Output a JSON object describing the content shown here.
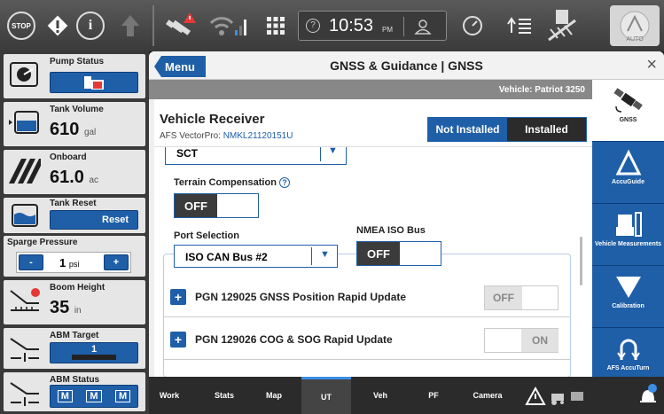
{
  "topbar": {
    "stop_label": "STOP",
    "info_label": "i",
    "clock_time": "10:53",
    "clock_ampm": "PM",
    "auto_label": "AUTO"
  },
  "left_panel": {
    "pump_status": {
      "title": "Pump Status"
    },
    "tank_volume": {
      "title": "Tank Volume",
      "value": "610",
      "unit": "gal"
    },
    "onboard": {
      "title": "Onboard",
      "value": "61.0",
      "unit": "ac"
    },
    "tank_reset": {
      "title": "Tank Reset",
      "button": "Reset"
    },
    "sparge": {
      "title": "Sparge Pressure",
      "value": "1",
      "unit": "psi",
      "minus": "-",
      "plus": "+"
    },
    "boom_height": {
      "title": "Boom Height",
      "value": "35",
      "unit": "in"
    },
    "abm_target": {
      "title": "ABM Target",
      "value": "1"
    },
    "abm_status": {
      "title": "ABM Status",
      "badges": [
        "M",
        "M",
        "M"
      ]
    }
  },
  "header": {
    "menu": "Menu",
    "title": "GNSS & Guidance | GNSS",
    "close": "×"
  },
  "vehicle_bar": "Vehicle: Patriot 3250",
  "receiver": {
    "title": "Vehicle Receiver",
    "subtitle_prefix": "AFS VectorPro: ",
    "subtitle_id": "NMKL21120151U",
    "not_installed": "Not Installed",
    "installed": "Installed"
  },
  "dropdown_top_value": "SCT",
  "terrain": {
    "label": "Terrain Compensation",
    "help": "?",
    "toggle": "OFF"
  },
  "port": {
    "label": "Port Selection",
    "value": "ISO CAN Bus #2"
  },
  "nmea": {
    "label": "NMEA ISO Bus",
    "toggle": "OFF"
  },
  "pgn_rows": [
    {
      "label": "PGN 129025 GNSS Position Rapid Update",
      "state": "OFF"
    },
    {
      "label": "PGN 129026 COG & SOG Rapid Update",
      "state": "ON"
    }
  ],
  "right_tabs": [
    {
      "label": "GNSS",
      "icon": "satellite-icon"
    },
    {
      "label": "AccuGuide",
      "icon": "accuguide-icon"
    },
    {
      "label": "Vehicle Measurements",
      "icon": "vehicle-icon"
    },
    {
      "label": "Calibration",
      "icon": "calibration-icon"
    },
    {
      "label": "AFS AccuTurn",
      "icon": "accuturn-icon"
    }
  ],
  "bottom_tabs": [
    "Work",
    "Stats",
    "Map",
    "UT",
    "Veh",
    "PF",
    "Camera"
  ],
  "colors": {
    "accent": "#1f5fa8",
    "topbar": "#4a4a4a",
    "panel": "#ffffff"
  }
}
